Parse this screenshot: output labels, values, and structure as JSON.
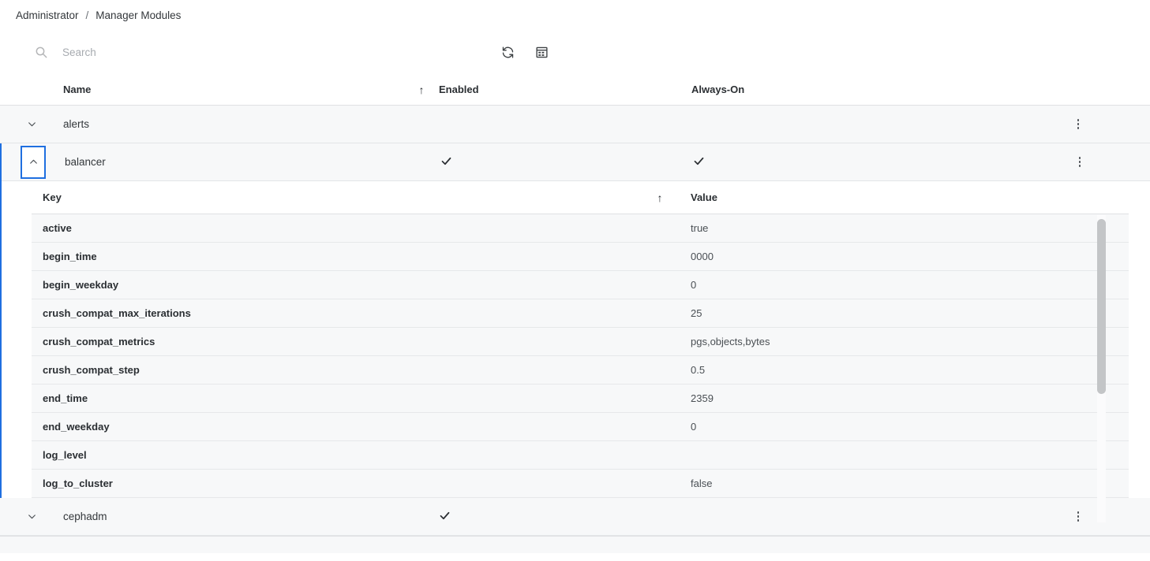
{
  "breadcrumb": {
    "root": "Administrator",
    "separator": "/",
    "current": "Manager Modules"
  },
  "toolbar": {
    "search_value": "",
    "search_placeholder": "Search",
    "refresh_label": "refresh-icon",
    "columns_label": "table-columns-icon"
  },
  "table": {
    "columns": {
      "name": "Name",
      "enabled": "Enabled",
      "always_on": "Always-On",
      "sort_indicator": "↑"
    },
    "modules": [
      {
        "name": "alerts",
        "enabled": false,
        "always_on": false,
        "expanded": false,
        "focused": false
      },
      {
        "name": "balancer",
        "enabled": true,
        "always_on": true,
        "expanded": true,
        "focused": true
      },
      {
        "name": "cephadm",
        "enabled": true,
        "always_on": false,
        "expanded": false,
        "focused": false
      }
    ]
  },
  "details": {
    "columns": {
      "key": "Key",
      "value": "Value",
      "sort_indicator": "↑"
    },
    "rows": [
      {
        "key": "active",
        "value": "true"
      },
      {
        "key": "begin_time",
        "value": "0000"
      },
      {
        "key": "begin_weekday",
        "value": "0"
      },
      {
        "key": "crush_compat_max_iterations",
        "value": "25"
      },
      {
        "key": "crush_compat_metrics",
        "value": "pgs,objects,bytes"
      },
      {
        "key": "crush_compat_step",
        "value": "0.5"
      },
      {
        "key": "end_time",
        "value": "2359"
      },
      {
        "key": "end_weekday",
        "value": "0"
      },
      {
        "key": "log_level",
        "value": ""
      },
      {
        "key": "log_to_cluster",
        "value": "false"
      }
    ]
  },
  "colors": {
    "accent": "#1f6fe0",
    "row_bg": "#f7f8f9",
    "text": "#2b2f33",
    "muted": "#6b7076",
    "divider": "#e3e5e7"
  }
}
